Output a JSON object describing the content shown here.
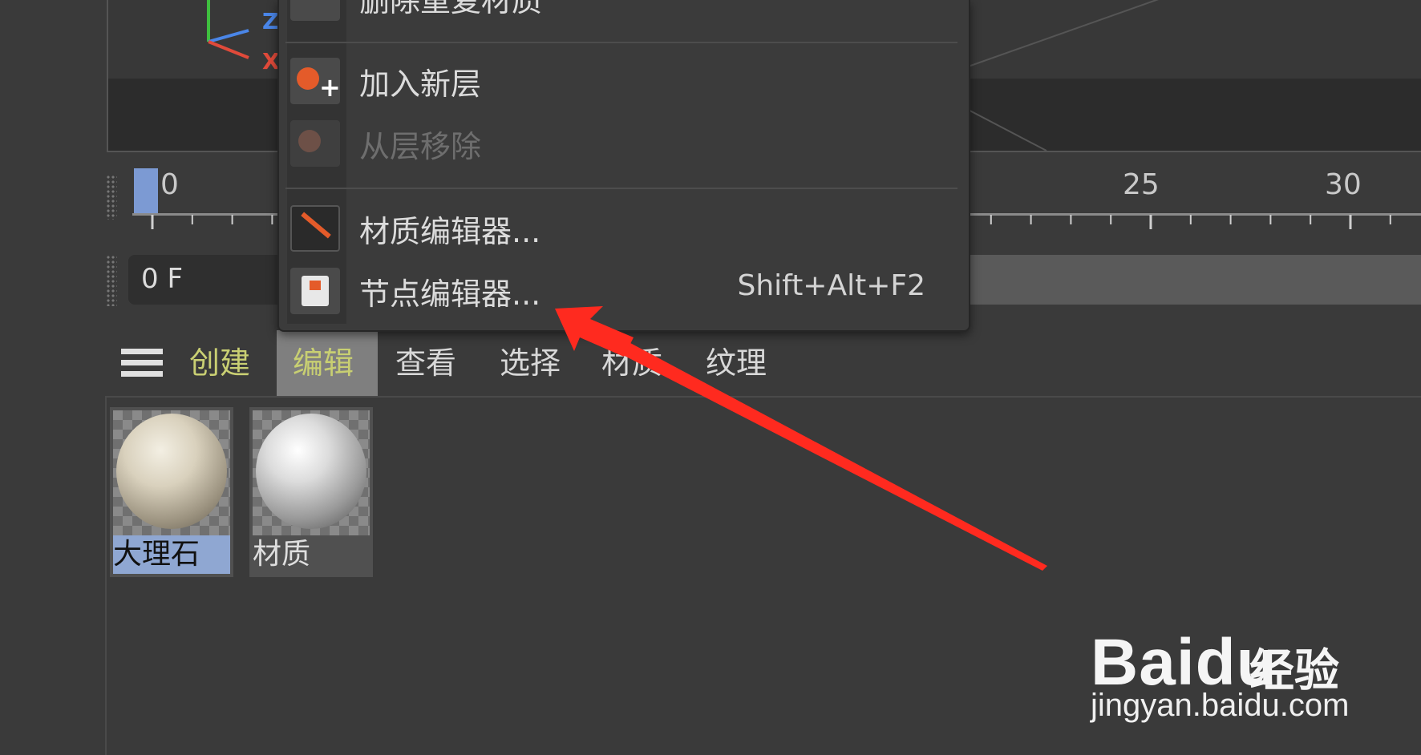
{
  "viewport": {
    "axis_z": "Z",
    "axis_x": "X"
  },
  "timeline": {
    "start_frame": "0",
    "tick_25": "25",
    "tick_30": "30",
    "current_frame": "0 F"
  },
  "context_menu": {
    "items": [
      {
        "label": "删除重复材质",
        "icon": "duplicate-material-icon",
        "enabled": true
      },
      {
        "label": "加入新层",
        "icon": "add-layer-icon",
        "enabled": true
      },
      {
        "label": "从层移除",
        "icon": "remove-layer-icon",
        "enabled": false
      },
      {
        "label": "材质编辑器...",
        "icon": "material-editor-icon",
        "enabled": true
      },
      {
        "label": "节点编辑器...",
        "icon": "node-editor-icon",
        "enabled": true,
        "shortcut": "Shift+Alt+F2"
      }
    ]
  },
  "material_manager": {
    "menu": [
      "创建",
      "编辑",
      "查看",
      "选择",
      "材质",
      "纹理"
    ],
    "active_menu": "编辑",
    "materials": [
      {
        "name": "大理石",
        "selected": true
      },
      {
        "name": "材质",
        "selected": false
      }
    ]
  },
  "watermark": {
    "logo": "Baidu",
    "sub": "经验",
    "url": "jingyan.baidu.com"
  },
  "colors": {
    "accent_yellow": "#c9cf73",
    "playhead_blue": "#7c9ad3",
    "arrow_red": "#ff2a1f",
    "selection_blue": "#8fa7d2"
  }
}
